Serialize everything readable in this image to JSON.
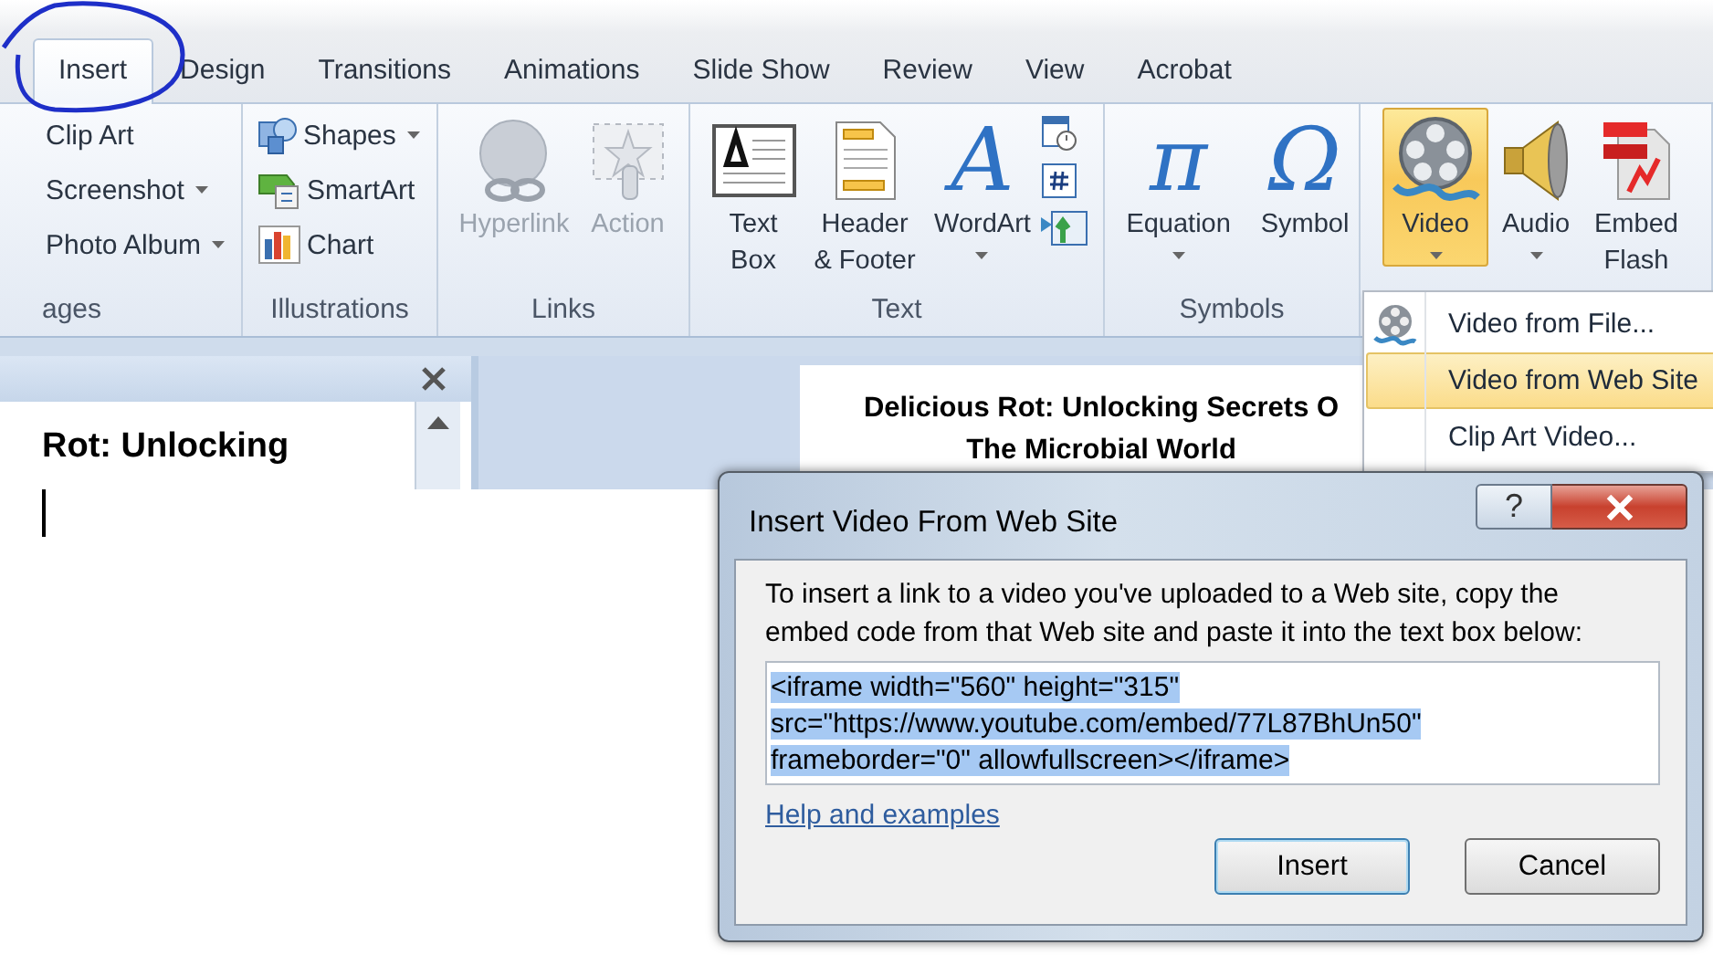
{
  "tabs": [
    {
      "label": "Insert",
      "selected": true
    },
    {
      "label": "Design",
      "selected": false
    },
    {
      "label": "Transitions",
      "selected": false
    },
    {
      "label": "Animations",
      "selected": false
    },
    {
      "label": "Slide Show",
      "selected": false
    },
    {
      "label": "Review",
      "selected": false
    },
    {
      "label": "View",
      "selected": false
    },
    {
      "label": "Acrobat",
      "selected": false
    }
  ],
  "ribbon": {
    "groups": [
      {
        "label": "ages",
        "items": [
          {
            "kind": "small",
            "label": "Clip Art",
            "dropdown": false
          },
          {
            "kind": "small",
            "label": "Screenshot",
            "dropdown": true
          },
          {
            "kind": "small",
            "label": "Photo Album",
            "dropdown": true
          }
        ]
      },
      {
        "label": "Illustrations",
        "items": [
          {
            "kind": "small",
            "label": "Shapes",
            "dropdown": true
          },
          {
            "kind": "small",
            "label": "SmartArt",
            "dropdown": false
          },
          {
            "kind": "small",
            "label": "Chart",
            "dropdown": false
          }
        ]
      },
      {
        "label": "Links",
        "items": [
          {
            "kind": "large",
            "label": "Hyperlink",
            "dropdown": false,
            "disabled": true
          },
          {
            "kind": "large",
            "label": "Action",
            "dropdown": false,
            "disabled": true
          }
        ]
      },
      {
        "label": "Text",
        "items": [
          {
            "kind": "large",
            "label": "Text Box",
            "dropdown": false
          },
          {
            "kind": "large",
            "label": "Header & Footer",
            "dropdown": false
          },
          {
            "kind": "large",
            "label": "WordArt",
            "glyph": "A",
            "dropdown": true
          },
          {
            "kind": "icon-column"
          }
        ]
      },
      {
        "label": "Symbols",
        "items": [
          {
            "kind": "large",
            "label": "Equation",
            "glyph": "π",
            "dropdown": true
          },
          {
            "kind": "large",
            "label": "Symbol",
            "glyph": "Ω",
            "dropdown": false
          }
        ]
      },
      {
        "items": [
          {
            "kind": "large",
            "label": "Video",
            "dropdown": true,
            "pressed": true
          },
          {
            "kind": "large",
            "label": "Audio",
            "dropdown": true,
            "pressed": false
          },
          {
            "kind": "large",
            "label": "Embed Flash",
            "dropdown": false,
            "pressed": false
          }
        ]
      }
    ]
  },
  "menu": {
    "items": [
      {
        "label": "Video from File...",
        "selected": false
      },
      {
        "label": "Video from Web Site",
        "selected": true
      },
      {
        "label": "Clip Art Video...",
        "selected": false
      }
    ]
  },
  "outline_pane": {
    "text": "Rot: Unlocking"
  },
  "slide": {
    "title_lines": [
      "Delicious Rot: Unlocking Secrets O",
      "The Microbial World"
    ]
  },
  "dialog": {
    "title": "Insert Video From Web Site",
    "help_button": "?",
    "instructions": "To insert a link to a video you've uploaded to a Web site, copy the embed code from that Web site and paste it into the text box below:",
    "embed_code": "<iframe width=\"560\" height=\"315\" src=\"https://www.youtube.com/embed/77L87BhUn50\" frameborder=\"0\" allowfullscreen></iframe>",
    "code_selected": true,
    "help_link": "Help and examples",
    "buttons": [
      {
        "label": "Insert",
        "default": true
      },
      {
        "label": "Cancel",
        "default": false
      }
    ]
  }
}
